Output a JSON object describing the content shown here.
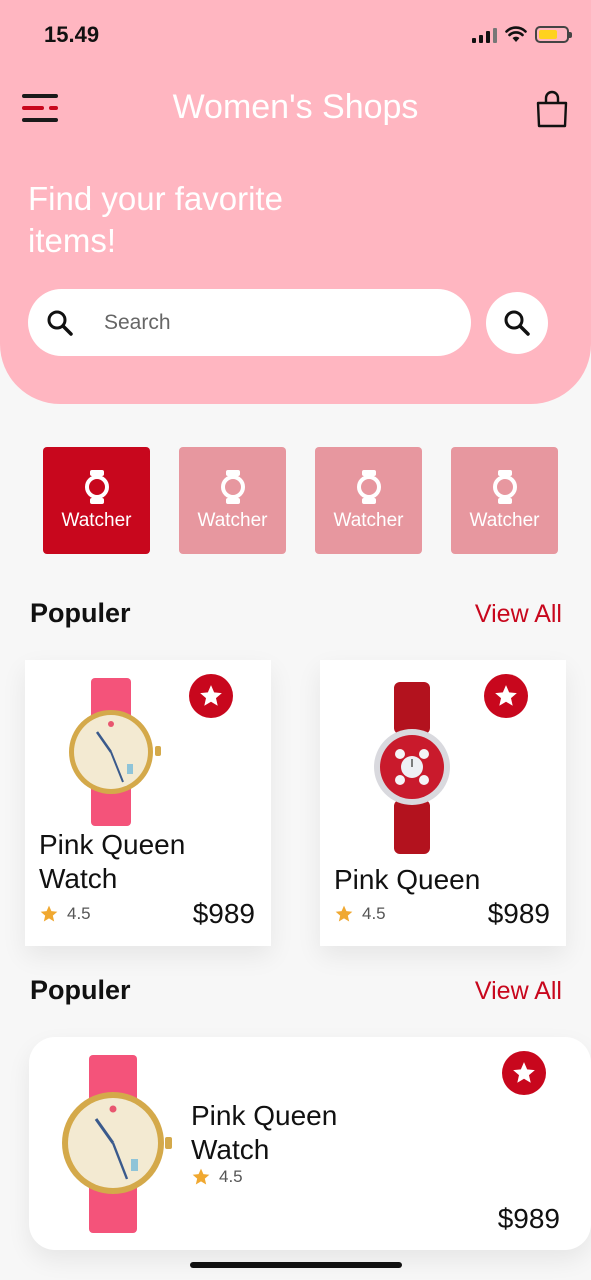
{
  "status_bar": {
    "time": "15.49"
  },
  "header": {
    "title": "Women's Shops",
    "tagline": "Find your favorite items!",
    "search_placeholder": "Search"
  },
  "categories": [
    {
      "label": "Watcher",
      "active": true
    },
    {
      "label": "Watcher",
      "active": false
    },
    {
      "label": "Watcher",
      "active": false
    },
    {
      "label": "Watcher",
      "active": false
    }
  ],
  "sections": [
    {
      "title": "Populer",
      "view_all": "View All"
    },
    {
      "title": "Populer",
      "view_all": "View All"
    }
  ],
  "popular_products": [
    {
      "name": "Pink Queen Watch",
      "rating": "4.5",
      "price": "$989",
      "icon": "pink-strap-watch"
    },
    {
      "name": "Pink Queen",
      "rating": "4.5",
      "price": "$989",
      "icon": "red-diamond-watch"
    }
  ],
  "featured_product": {
    "name": "Pink Queen Watch",
    "rating": "4.5",
    "price": "$989",
    "icon": "pink-strap-watch"
  },
  "colors": {
    "header_pink": "#ffb6c1",
    "accent_red": "#c8071d",
    "inactive_category": "#e7979f",
    "star": "#f0a830"
  }
}
